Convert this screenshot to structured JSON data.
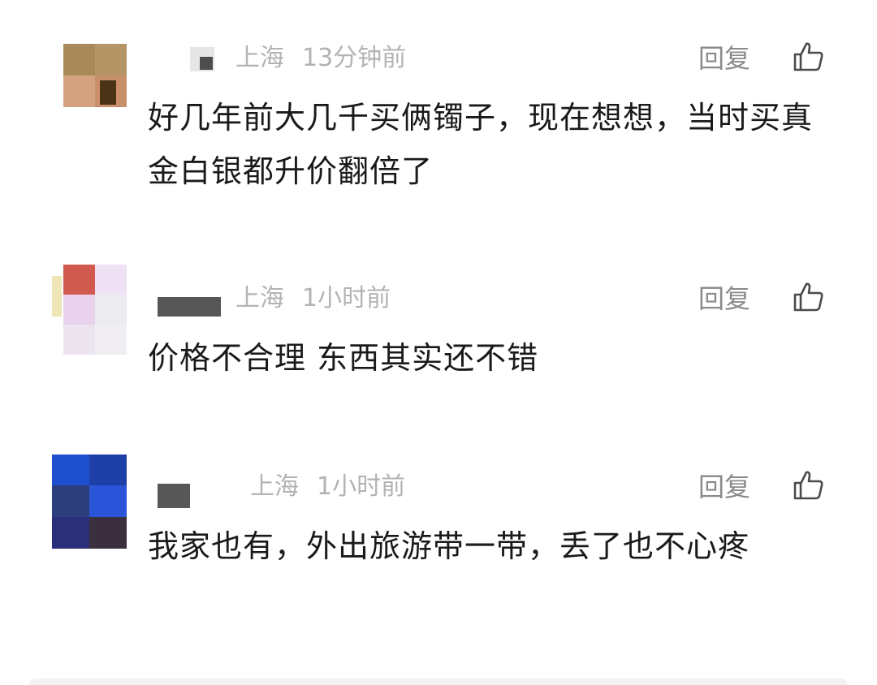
{
  "comments": [
    {
      "location": "上海",
      "time": "13分钟前",
      "reply_label": "回复",
      "text": "好几年前大几千买俩镯子，现在想想，当时买真金白银都升价翻倍了"
    },
    {
      "location": "上海",
      "time": "1小时前",
      "reply_label": "回复",
      "text": "价格不合理 东西其实还不错"
    },
    {
      "location": "上海",
      "time": "1小时前",
      "reply_label": "回复",
      "text": "我家也有，外出旅游带一带，丢了也不心疼"
    }
  ],
  "icons": {
    "like": "thumbs-up-icon"
  },
  "colors": {
    "meta_text": "#b3b3b3",
    "reply_text": "#8a8a8a",
    "body_text": "#1a1a1a"
  }
}
